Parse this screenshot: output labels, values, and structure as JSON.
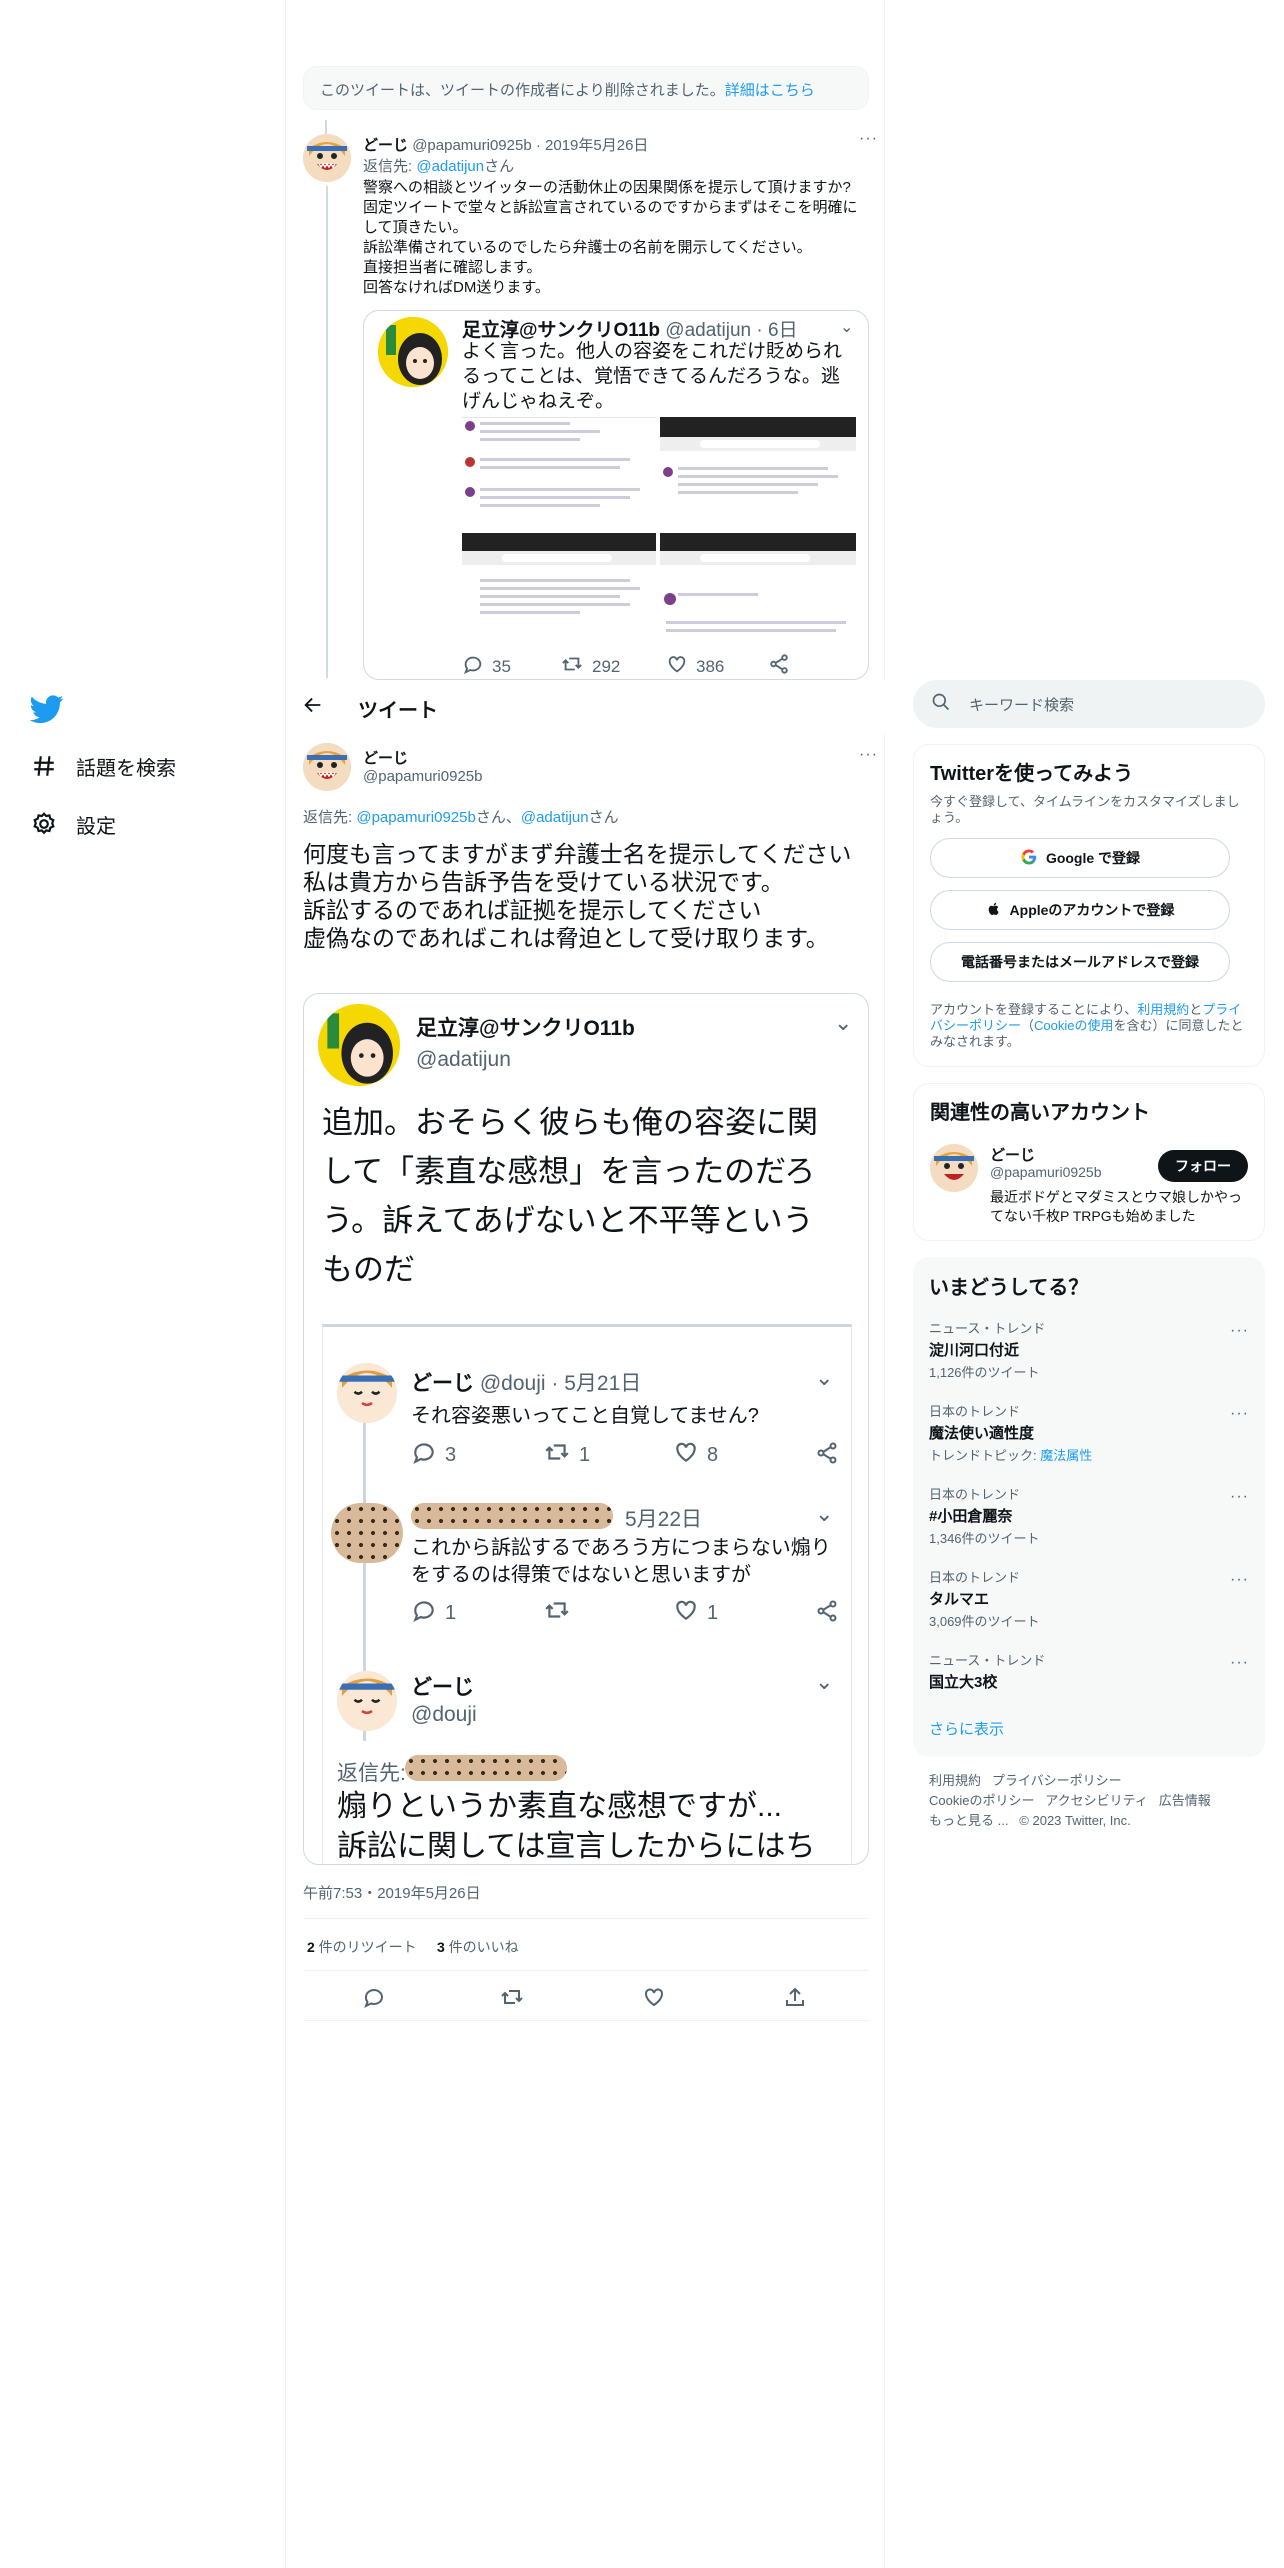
{
  "nav": {
    "items": [
      {
        "label": "話題を検索"
      },
      {
        "label": "設定"
      }
    ]
  },
  "deleted_notice": {
    "text": "このツイートは、ツイートの作成者により削除されました。",
    "link": "詳細はこちら"
  },
  "reply_tweet": {
    "author_name": "どーじ",
    "handle": "@papamuri0925b",
    "date": "2019年5月26日",
    "reply_prefix": "返信先: ",
    "reply_to": "@adatijun",
    "reply_suffix": "さん",
    "text": "警察への相談とツイッターの活動休止の因果関係を提示して頂けますか?\n固定ツイートで堂々と訴訟宣言されているのですからまずはそこを明確にして頂きたい。\n訴訟準備されているのでしたら弁護士の名前を開示してください。\n直接担当者に確認します。\n回答なければDM送ります。",
    "quote": {
      "author_name": "足立淳@サンクリO11b",
      "handle": "@adatijun",
      "age": "6日",
      "text": "よく言った。他人の容姿をこれだけ貶められるってことは、覚悟できてるんだろうな。逃げんじゃねえぞ。",
      "replies": "35",
      "retweets": "292",
      "likes": "386"
    }
  },
  "header": {
    "title": "ツイート"
  },
  "main_tweet": {
    "author_name": "どーじ",
    "handle": "@papamuri0925b",
    "reply_prefix": "返信先: ",
    "reply_to_1": "@papamuri0925b",
    "reply_mid": "さん、",
    "reply_to_2": "@adatijun",
    "reply_suffix": "さん",
    "text": "何度も言ってますがまず弁護士名を提示してください\n私は貴方から告訴予告を受けている状況です。\n訴訟するのであれば証拠を提示してください\n虚偽なのであればこれは脅迫として受け取ります。",
    "quote": {
      "author_name": "足立淳@サンクリO11b",
      "handle": "@adatijun",
      "text": "追加。おそらく彼らも俺の容姿に関して「素直な感想」を言ったのだろう。訴えてあげないと不平等というものだ",
      "inner": {
        "t1_name": "どーじ",
        "t1_handle": "@douji",
        "t1_date": "5月21日",
        "t1_text": "それ容姿悪いってこと自覚してません?",
        "t1_replies": "3",
        "t1_retweets": "1",
        "t1_likes": "8",
        "t2_date": "5月22日",
        "t2_text": "これから訴訟するであろう方につまらない煽りをするのは得策ではないと思いますが",
        "t2_replies": "1",
        "t2_likes": "1",
        "t3_name": "どーじ",
        "t3_handle": "@douji",
        "t3_reply_prefix": "返信先:",
        "t3_text_1": "煽りというか素直な感想ですが...",
        "t3_text_2": "訴訟に関しては宣言したからにはち"
      }
    },
    "timestamp": "午前7:53・2019年5月26日",
    "retweets_count": "2",
    "retweets_label": " 件のリツイート",
    "likes_count": "3",
    "likes_label": " 件のいいね"
  },
  "right": {
    "search_placeholder": "キーワード検索",
    "signup": {
      "title": "Twitterを使ってみよう",
      "subtitle": "今すぐ登録して、タイムラインをカスタマイズしましょう。",
      "google_btn": "Google で登録",
      "apple_btn": "Appleのアカウントで登録",
      "phone_btn": "電話番号またはメールアドレスで登録",
      "terms_1": "アカウントを登録することにより、",
      "terms_link_1": "利用規約",
      "terms_2": "と",
      "terms_link_2": "プライバシーポリシー",
      "terms_3": "（",
      "terms_link_3": "Cookieの使用",
      "terms_4": "を含む）に同意したとみなされます。"
    },
    "related": {
      "title": "関連性の高いアカウント",
      "name": "どーじ",
      "handle": "@papamuri0925b",
      "follow": "フォロー",
      "bio": "最近ボドゲとマダミスとウマ娘しかやってない千枚P TRPGも始めました"
    },
    "trends": {
      "title": "いまどうしてる？",
      "items": [
        {
          "category": "ニュース・トレンド",
          "name": "淀川河口付近",
          "count": "1,126件のツイート"
        },
        {
          "category": "日本のトレンド",
          "name": "魔法使い適性度",
          "count_prefix": "トレンドトピック: ",
          "count_link": "魔法属性"
        },
        {
          "category": "日本のトレンド",
          "name": "#小田倉麗奈",
          "count": "1,346件のツイート"
        },
        {
          "category": "日本のトレンド",
          "name": "タルマエ",
          "count": "3,069件のツイート"
        },
        {
          "category": "ニュース・トレンド",
          "name": "国立大3校",
          "count": ""
        }
      ],
      "show_more": "さらに表示"
    },
    "footer": {
      "l1": "利用規約",
      "l2": "プライバシーポリシー",
      "l3": "Cookieのポリシー",
      "l4": "アクセシビリティ",
      "l5": "広告情報",
      "l6": "もっと見る ...",
      "copyright": "© 2023 Twitter, Inc."
    }
  },
  "colors": {
    "accent": "#1d9bf0",
    "text": "#0f1419",
    "muted": "#536471",
    "border": "#eff3f4"
  }
}
